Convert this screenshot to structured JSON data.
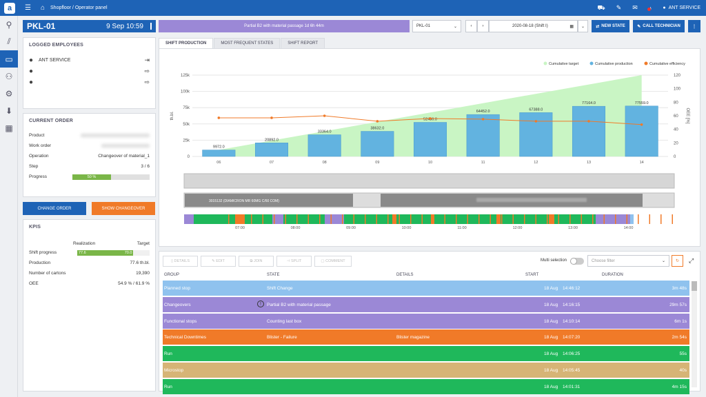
{
  "topbar": {
    "crumb": "Shopfloor / Operator panel",
    "user": "ANT SERVICE"
  },
  "header": {
    "machine": "PKL-01",
    "datetime": "9 Sep 10:59",
    "status": "Partial B2 with material passage 1d 6h 44m",
    "machine_select": "PKL-01",
    "shift": "2020-08-18 (Shift I)",
    "new_state": "NEW STATE",
    "call_tech": "CALL TECHNICIAN"
  },
  "employees": {
    "title": "LOGGED EMPLOYEES",
    "list": [
      "ANT SERVICE",
      "",
      ""
    ]
  },
  "order": {
    "title": "CURRENT ORDER",
    "rows": [
      {
        "label": "Product",
        "value": ""
      },
      {
        "label": "Work order",
        "value": ""
      },
      {
        "label": "Operation",
        "value": "Changeover of material_1"
      },
      {
        "label": "Step",
        "value": "3 / 6"
      }
    ],
    "progress_label": "Progress",
    "progress_text": "50 %",
    "progress": 0.5
  },
  "buttons": {
    "change_order": "CHANGE ORDER",
    "show_changeover": "SHOW CHANGEOVER"
  },
  "kpis": {
    "title": "KPIS",
    "realization": "Realization",
    "target": "Target",
    "shift_progress": "Shift progress",
    "sp_real": "77.6",
    "sp_target": "70.0",
    "sp_fraction": 0.776,
    "rows": [
      {
        "label": "Production",
        "value": "77.6 th.bl."
      },
      {
        "label": "Number of cartons",
        "value": "19,390"
      },
      {
        "label": "OEE",
        "value": "54.9 % / 61.9 %"
      }
    ]
  },
  "tabs": [
    "SHIFT PRODUCTION",
    "MOST FREQUENT STATES",
    "SHIFT REPORT"
  ],
  "chart_data": {
    "type": "bar",
    "categories": [
      "06",
      "07",
      "08",
      "09",
      "10",
      "11",
      "12",
      "13",
      "14"
    ],
    "series": [
      {
        "name": "Cumulative target",
        "type": "area",
        "values": [
          null,
          null,
          null,
          null,
          null,
          null,
          null,
          null,
          null
        ]
      },
      {
        "name": "Cumulative production",
        "type": "bar",
        "values": [
          9972.0,
          20892.0,
          33364.0,
          38632.0,
          52436.0,
          64452.0,
          67388.0,
          77164.0,
          77559.0
        ]
      },
      {
        "name": "Cumulative efficiency",
        "type": "line",
        "values": [
          57,
          57,
          60,
          52,
          56,
          55,
          52,
          52,
          47
        ]
      }
    ],
    "ylabel": "th.bl.",
    "y2label": "OEE [%]",
    "ylim": [
      0,
      125000
    ],
    "y2lim": [
      0,
      120
    ],
    "yticks": [
      "0",
      "25k",
      "50k",
      "75k",
      "100k",
      "125k"
    ],
    "y2ticks": [
      "0",
      "20",
      "40",
      "60",
      "80",
      "100",
      "120"
    ],
    "bar_labels": [
      "9972.0",
      "20892.0",
      "33364.0",
      "38632.0",
      "52436.0",
      "64452.0",
      "67388.0",
      "77164.0",
      "77559.0"
    ],
    "colors": {
      "target": "#c9f5c4",
      "bar": "#62b3e0",
      "line": "#f07a28"
    }
  },
  "timeline": {
    "order_text": "3015132 (DIAMICRON MR 60MG C/60 COM)",
    "times": [
      "07:00",
      "08:00",
      "09:00",
      "10:00",
      "11:00",
      "12:00",
      "13:00",
      "14:00"
    ]
  },
  "actions": {
    "details": "DETAILS",
    "edit": "EDIT",
    "join": "JOIN",
    "split": "SPLIT",
    "comment": "COMMENT",
    "multi": "Multi selection",
    "filter": "Choose filter"
  },
  "table": {
    "headers": [
      "GROUP",
      "STATE",
      "DETAILS",
      "START",
      "DURATION"
    ],
    "rows": [
      {
        "group": "Planned stop",
        "state": "Shift Change",
        "details": "",
        "date": "18 Aug",
        "time": "14:46:12",
        "dur": "3m 48s",
        "color": "#8fc2ee"
      },
      {
        "group": "Changeovers",
        "state": "Partial B2 with material passage",
        "details": "",
        "date": "18 Aug",
        "time": "14:16:15",
        "dur": "29m 57s",
        "color": "#9b88d6"
      },
      {
        "group": "Functional stops",
        "state": "Counting last box",
        "details": "",
        "date": "18 Aug",
        "time": "14:10:14",
        "dur": "6m 1s",
        "color": "#9b88d6"
      },
      {
        "group": "Technical Downtimes",
        "state": "Blister - Failure",
        "details": "Blister magazine",
        "date": "18 Aug",
        "time": "14:07:20",
        "dur": "2m 54s",
        "color": "#f07a28"
      },
      {
        "group": "Run",
        "state": "",
        "details": "",
        "date": "18 Aug",
        "time": "14:06:25",
        "dur": "55s",
        "color": "#1fb85b"
      },
      {
        "group": "Microstop",
        "state": "",
        "details": "",
        "date": "18 Aug",
        "time": "14:05:45",
        "dur": "40s",
        "color": "#d6b476"
      },
      {
        "group": "Run",
        "state": "",
        "details": "",
        "date": "18 Aug",
        "time": "14:01:31",
        "dur": "4m 15s",
        "color": "#1fb85b"
      }
    ]
  }
}
